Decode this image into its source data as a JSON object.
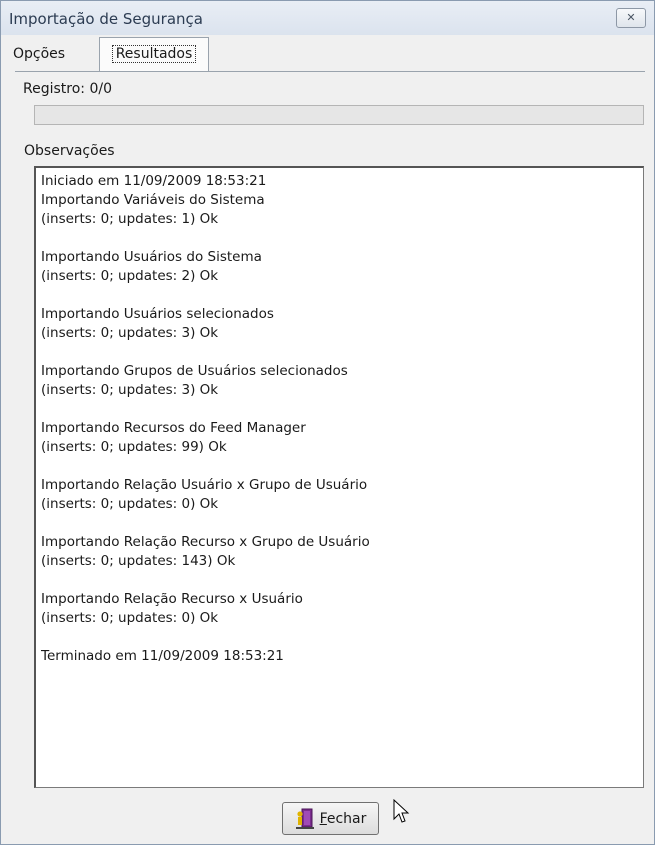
{
  "window": {
    "title": "Importação de Segurança",
    "close_glyph": "✕"
  },
  "tabs": [
    {
      "label": "Opções",
      "selected": false
    },
    {
      "label": "Resultados",
      "selected": true
    }
  ],
  "registro": {
    "label": "Registro: 0/0",
    "progress": 0
  },
  "observacoes": {
    "label": "Observações",
    "lines": [
      "Iniciado em 11/09/2009 18:53:21",
      "Importando Variáveis do Sistema",
      "(inserts: 0; updates: 1) Ok",
      "",
      "Importando Usuários do Sistema",
      "(inserts: 0; updates: 2) Ok",
      "",
      "Importando Usuários selecionados",
      "(inserts: 0; updates: 3) Ok",
      "",
      "Importando Grupos de Usuários selecionados",
      "(inserts: 0; updates: 3) Ok",
      "",
      "Importando Recursos do Feed Manager",
      "(inserts: 0; updates: 99) Ok",
      "",
      "Importando Relação Usuário x Grupo de Usuário",
      "(inserts: 0; updates: 0) Ok",
      "",
      "Importando Relação Recurso x Grupo de Usuário",
      "(inserts: 0; updates: 143) Ok",
      "",
      "Importando Relação Recurso x Usuário",
      "(inserts: 0; updates: 0) Ok",
      "",
      "Terminado em 11/09/2009 18:53:21"
    ]
  },
  "buttons": {
    "fechar_mnemonic": "F",
    "fechar_rest": "echar",
    "fechar_icon": "door-exit-icon"
  },
  "colors": {
    "title_text": "#2c3c52",
    "icon_door": "#7b2d8e",
    "icon_person": "#e0b400"
  }
}
